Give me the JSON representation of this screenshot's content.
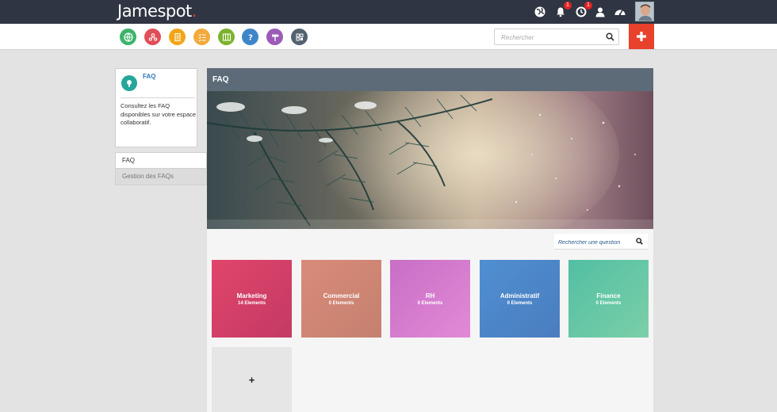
{
  "brand": {
    "name": "Jamespot",
    "dot": "."
  },
  "topbar": {
    "notifications_badge": "1",
    "activity_badge": "1"
  },
  "appbar": {
    "apps": [
      {
        "icon": "globe-icon",
        "color": "#3db36b"
      },
      {
        "icon": "people-icon",
        "color": "#e04e59"
      },
      {
        "icon": "document-icon",
        "color": "#f2a516"
      },
      {
        "icon": "checklist-icon",
        "color": "#f3a93c"
      },
      {
        "icon": "board-icon",
        "color": "#7bb32e"
      },
      {
        "icon": "question-icon",
        "color": "#3e86c8"
      },
      {
        "icon": "signpost-icon",
        "color": "#9c5bb8"
      },
      {
        "icon": "grid-icon",
        "color": "#546270"
      }
    ],
    "search_placeholder": "Rechercher"
  },
  "sidebar": {
    "title": "FAQ",
    "description": "Consultez les FAQ disponibles sur votre espace collaboratif.",
    "nav": [
      {
        "label": "FAQ",
        "active": true
      },
      {
        "label": "Gestion des FAQs",
        "active": false
      }
    ]
  },
  "main": {
    "title": "FAQ",
    "question_search_placeholder": "Rechercher une question",
    "categories": [
      {
        "name": "Marketing",
        "count": "14 Elements",
        "color_from": "#e1456b",
        "color_to": "#c33a64"
      },
      {
        "name": "Commercial",
        "count": "0 Elements",
        "color_from": "#d98b7a",
        "color_to": "#c5806f"
      },
      {
        "name": "RH",
        "count": "0 Elements",
        "color_from": "#c86ec6",
        "color_to": "#e28ad6"
      },
      {
        "name": "Administratif",
        "count": "0 Elements",
        "color_from": "#4f8fd1",
        "color_to": "#4a7dbf"
      },
      {
        "name": "Finance",
        "count": "0 Elements",
        "color_from": "#52bfa3",
        "color_to": "#7bcfa8"
      }
    ],
    "add_label": "+"
  }
}
